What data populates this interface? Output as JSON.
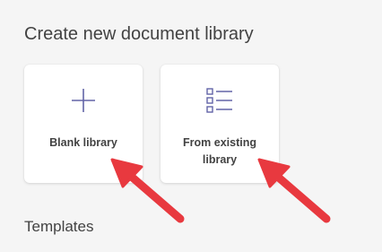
{
  "page": {
    "heading": "Create new document library",
    "templates_title": "Templates"
  },
  "cards": {
    "blank": {
      "label": "Blank library",
      "icon": "plus-icon"
    },
    "existing": {
      "label": "From existing library",
      "icon": "list-icon"
    }
  },
  "colors": {
    "icon_accent": "#6264a7",
    "arrow": "#e8393f"
  }
}
